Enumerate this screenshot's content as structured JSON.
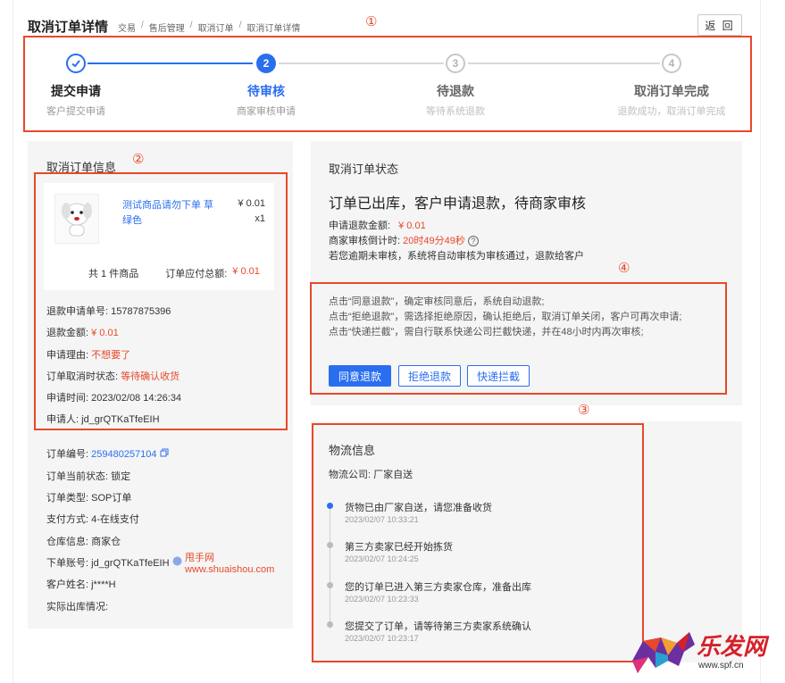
{
  "header": {
    "title": "取消订单详情",
    "breadcrumbs": [
      "交易",
      "售后管理",
      "取消订单",
      "取消订单详情"
    ],
    "back_label": "返 回"
  },
  "markers": [
    "①",
    "②",
    "③",
    "④"
  ],
  "steps": [
    {
      "num": "",
      "title": "提交申请",
      "sub": "客户提交申请",
      "state": "done"
    },
    {
      "num": "2",
      "title": "待审核",
      "sub": "商家审核申请",
      "state": "active"
    },
    {
      "num": "3",
      "title": "待退款",
      "sub": "等待系统退款",
      "state": "todo"
    },
    {
      "num": "4",
      "title": "取消订单完成",
      "sub": "退款成功，取消订单完成",
      "state": "todo"
    }
  ],
  "order_info": {
    "heading": "取消订单信息",
    "product": {
      "name": "测试商品请勿下单 草绿色",
      "price": "¥ 0.01",
      "qty": "x1",
      "count_text": "共 1 件商品",
      "total_label": "订单应付总额:",
      "total_value": "¥ 0.01"
    },
    "refund_no_label": "退款申请单号:",
    "refund_no": "15787875396",
    "refund_amount_label": "退款金额:",
    "refund_amount": "¥ 0.01",
    "reason_label": "申请理由:",
    "reason": "不想要了",
    "cancel_status_label": "订单取消时状态:",
    "cancel_status": "等待确认收货",
    "apply_time_label": "申请时间:",
    "apply_time": "2023/02/08 14:26:34",
    "applicant_label": "申请人:",
    "applicant": "jd_grQTKaTfeEIH",
    "order_no_label": "订单编号:",
    "order_no": "259480257104",
    "current_status": "订单当前状态: 锁定",
    "order_type": "订单类型: SOP订单",
    "pay_method": "支付方式: 4-在线支付",
    "warehouse": "仓库信息: 商家仓",
    "account_label": "下单账号:",
    "account": "jd_grQTKaTfeEIH",
    "customer": "客户姓名: j****H",
    "actual_out": "实际出库情况:"
  },
  "cancel_status": {
    "heading": "取消订单状态",
    "big_text": "订单已出库，客户申请退款，待商家审核",
    "amount_label": "申请退款金额:",
    "amount": "¥ 0.01",
    "countdown_label": "商家审核倒计时:",
    "countdown": "20时49分49秒",
    "note": "若您逾期未审核，系统将自动审核为审核通过，退款给客户",
    "hints": [
      "点击“同意退款”，确定审核同意后，系统自动退款;",
      "点击“拒绝退款”，需选择拒绝原因，确认拒绝后，取消订单关闭，客户可再次申请;",
      "点击“快递拦截”，需自行联系快递公司拦截快递，并在48小时内再次审核;"
    ],
    "buttons": {
      "agree": "同意退款",
      "reject": "拒绝退款",
      "intercept": "快递拦截"
    }
  },
  "logistics": {
    "heading": "物流信息",
    "company": "物流公司: 厂家自送",
    "events": [
      {
        "text": "货物已由厂家自送，请您准备收货",
        "time": "2023/02/07 10:33:21"
      },
      {
        "text": "第三方卖家已经开始拣货",
        "time": "2023/02/07 10:24:25"
      },
      {
        "text": "您的订单已进入第三方卖家仓库，准备出库",
        "time": "2023/02/07 10:23:33"
      },
      {
        "text": "您提交了订单，请等待第三方卖家系统确认",
        "time": "2023/02/07 10:23:17"
      }
    ]
  },
  "watermark": {
    "name": "甩手网",
    "url": "www.shuaishou.com"
  },
  "logo": {
    "name": "乐发网",
    "url": "www.spf.cn"
  },
  "colors": {
    "accent": "#2a6ef0",
    "highlight": "#e8482b",
    "panel": "#f5f5f5"
  }
}
